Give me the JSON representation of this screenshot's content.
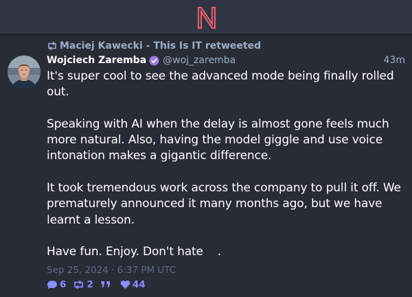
{
  "app": {
    "logo_letter": "N",
    "accent_color": "#e35d6a",
    "link_color": "#8c8dff"
  },
  "post": {
    "retweeted_by": "Maciej Kawecki - This Is IT retweeted",
    "author_name": "Wojciech Zaremba",
    "author_handle": "@woj_zaremba",
    "relative_time": "43m",
    "paragraphs": [
      "It's super cool to see the advanced mode being finally rolled out.",
      "Speaking with AI when the delay is almost gone feels much more natural. Also, having the model giggle and use voice intonation makes a gigantic difference.",
      "It took tremendous work across the company to pull it off. We prematurely announced it many months ago, but we have learnt a lesson.",
      "Have fun. Enjoy. Don't hate    ."
    ],
    "timestamp": "Sep 25, 2024 · 6:37 PM UTC",
    "stats": {
      "replies": "6",
      "retweets": "2",
      "quotes": "",
      "likes": "44"
    }
  }
}
